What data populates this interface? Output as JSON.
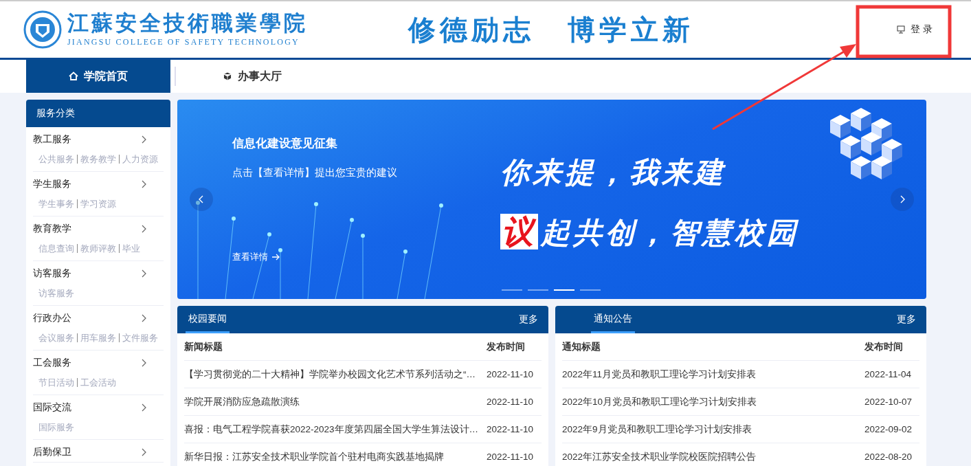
{
  "header": {
    "school_name": "江蘇安全技術職業學院",
    "school_name_en": "JIANGSU COLLEGE OF SAFETY TECHNOLOGY",
    "motto": [
      "修德励志",
      "博学立新"
    ],
    "login": "登 录"
  },
  "nav": [
    {
      "label": "学院首页",
      "kind": "home",
      "selected": true
    },
    {
      "label": "办事大厅",
      "kind": "service",
      "selected": false
    }
  ],
  "sidebar": {
    "title": "服务分类",
    "items": [
      {
        "label": "教工服务",
        "links": [
          "公共服务",
          "教务教学",
          "人力资源"
        ]
      },
      {
        "label": "学生服务",
        "links": [
          "学生事务",
          "学习资源"
        ]
      },
      {
        "label": "教育教学",
        "links": [
          "信息查询",
          "教师评教",
          "毕业"
        ]
      },
      {
        "label": "访客服务",
        "links": [
          "访客服务"
        ]
      },
      {
        "label": "行政办公",
        "links": [
          "会议服务",
          "用车服务",
          "文件服务"
        ]
      },
      {
        "label": "工会服务",
        "links": [
          "节日活动",
          "工会活动"
        ]
      },
      {
        "label": "国际交流",
        "links": [
          "国际服务"
        ]
      },
      {
        "label": "后勤保卫"
      }
    ]
  },
  "banner": {
    "title": "信息化建设意见征集",
    "subtitle": "点击【查看详情】提出您宝贵的建议",
    "link": "查看详情",
    "slogan_1": "你来提，我来建",
    "slogan_mark": "议",
    "slogan_2": "起共创，智慧校园",
    "dots": [
      {
        "selected": false
      },
      {
        "selected": false
      },
      {
        "selected": true
      },
      {
        "selected": false
      }
    ]
  },
  "panels": [
    {
      "title": "校园要闻",
      "more": "更多",
      "columns": [
        "新闻标题",
        "发布时间"
      ],
      "rows": [
        [
          "【学习贯彻党的二十大精神】学院举办校园文化艺术节系列活动之“…",
          "2022-11-10"
        ],
        [
          "学院开展消防应急疏散演练",
          "2022-11-10"
        ],
        [
          "喜报：电气工程学院喜获2022-2023年度第四届全国大学生算法设计…",
          "2022-11-10"
        ],
        [
          "新华日报：江苏安全技术职业学院首个驻村电商实践基地揭牌",
          "2022-11-10"
        ]
      ]
    },
    {
      "title": "通知公告",
      "more": "更多",
      "columns": [
        "通知标题",
        "发布时间"
      ],
      "rows": [
        [
          "2022年11月党员和教职工理论学习计划安排表",
          "2022-11-04"
        ],
        [
          "2022年10月党员和教职工理论学习计划安排表",
          "2022-10-07"
        ],
        [
          "2022年9月党员和教职工理论学习计划安排表",
          "2022-09-02"
        ],
        [
          "2022年江苏安全技术职业学院校医院招聘公告",
          "2022-08-20"
        ]
      ]
    }
  ]
}
